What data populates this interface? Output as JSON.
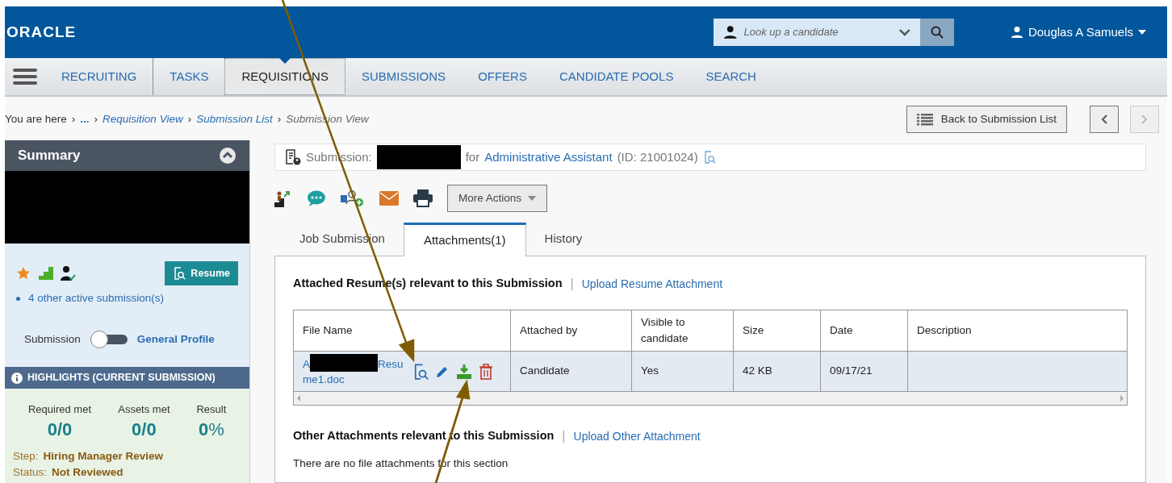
{
  "header": {
    "logo": "ORACLE",
    "search": {
      "placeholder": "Look up a candidate"
    },
    "user": "Douglas A Samuels"
  },
  "nav": [
    {
      "label": "RECRUITING",
      "selected": false
    },
    {
      "label": "TASKS",
      "selected": false
    },
    {
      "label": "REQUISITIONS",
      "selected": true
    },
    {
      "label": "SUBMISSIONS",
      "selected": false
    },
    {
      "label": "OFFERS",
      "selected": false
    },
    {
      "label": "CANDIDATE POOLS",
      "selected": false
    },
    {
      "label": "SEARCH",
      "selected": false
    }
  ],
  "breadcrumb": {
    "lead": "You are here",
    "separator": "›",
    "ellipsis": "...",
    "links": [
      "Requisition View",
      "Submission List"
    ],
    "current": "Submission View"
  },
  "back_button": "Back to Submission List",
  "summary": {
    "title": "Summary",
    "resume_button": "Resume",
    "other_submissions": "4 other active submission(s)",
    "toggle": {
      "left": "Submission",
      "right": "General Profile",
      "on": false
    },
    "highlights_title": "HIGHLIGHTS (CURRENT SUBMISSION)",
    "metrics": [
      {
        "label": "Required met",
        "value": "0/0"
      },
      {
        "label": "Assets met",
        "value": "0/0"
      },
      {
        "label": "Result",
        "value": "0",
        "unit": "%"
      }
    ],
    "step": {
      "label": "Step:",
      "value": "Hiring Manager Review"
    },
    "status": {
      "label": "Status:",
      "value": "Not Reviewed"
    }
  },
  "submission": {
    "label": "Submission:",
    "for": "for",
    "job": "Administrative Assistant",
    "id": "(ID: 21001024)"
  },
  "more_actions": "More Actions",
  "tabs": [
    {
      "label": "Job Submission",
      "selected": false
    },
    {
      "label": "Attachments(1)",
      "selected": true
    },
    {
      "label": "History",
      "selected": false
    }
  ],
  "resume_section": {
    "title": "Attached Resume(s) relevant to this Submission",
    "separator": "|",
    "link": "Upload Resume Attachment",
    "columns": [
      "File Name",
      "Attached by",
      "Visible to candidate",
      "Size",
      "Date",
      "Description"
    ],
    "rows": [
      {
        "file_name": [
          "A",
          "Resu",
          "me1.doc"
        ],
        "attached_by": "Candidate",
        "visible": "Yes",
        "size": "42 KB",
        "date": "09/17/21"
      }
    ]
  },
  "other_section": {
    "title": "Other Attachments relevant to this Submission",
    "separator": "|",
    "link": "Upload Other Attachment",
    "empty": "There are no file attachments for this section"
  }
}
